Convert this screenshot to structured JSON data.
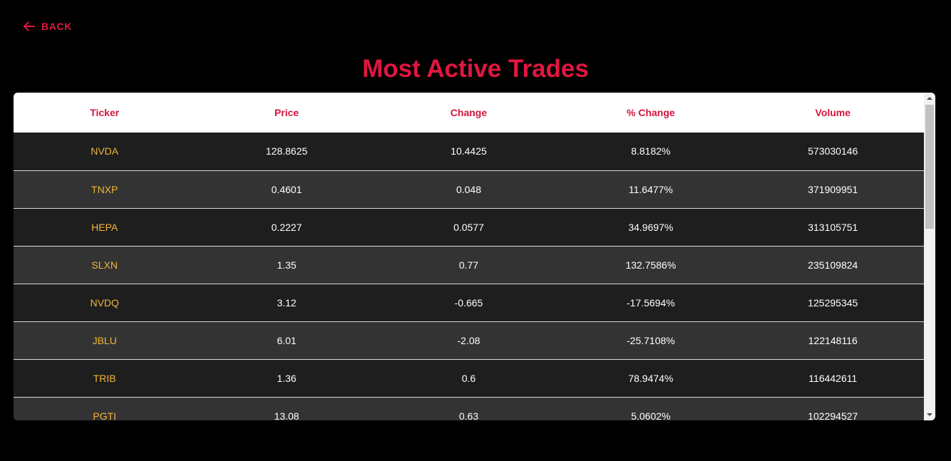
{
  "nav": {
    "back_label": "BACK",
    "back_icon": "arrow-left-icon"
  },
  "page": {
    "title": "Most Active Trades"
  },
  "colors": {
    "accent": "#e0173f",
    "ticker": "#f0b73a",
    "row_dark": "#1e1e1e",
    "row_light": "#333333",
    "header_bg": "#ffffff"
  },
  "table": {
    "columns": [
      "Ticker",
      "Price",
      "Change",
      "% Change",
      "Volume"
    ],
    "rows": [
      {
        "ticker": "NVDA",
        "price": "128.8625",
        "change": "10.4425",
        "pct_change": "8.8182%",
        "volume": "573030146"
      },
      {
        "ticker": "TNXP",
        "price": "0.4601",
        "change": "0.048",
        "pct_change": "11.6477%",
        "volume": "371909951"
      },
      {
        "ticker": "HEPA",
        "price": "0.2227",
        "change": "0.0577",
        "pct_change": "34.9697%",
        "volume": "313105751"
      },
      {
        "ticker": "SLXN",
        "price": "1.35",
        "change": "0.77",
        "pct_change": "132.7586%",
        "volume": "235109824"
      },
      {
        "ticker": "NVDQ",
        "price": "3.12",
        "change": "-0.665",
        "pct_change": "-17.5694%",
        "volume": "125295345"
      },
      {
        "ticker": "JBLU",
        "price": "6.01",
        "change": "-2.08",
        "pct_change": "-25.7108%",
        "volume": "122148116"
      },
      {
        "ticker": "TRIB",
        "price": "1.36",
        "change": "0.6",
        "pct_change": "78.9474%",
        "volume": "116442611"
      },
      {
        "ticker": "PGTI",
        "price": "13.08",
        "change": "0.63",
        "pct_change": "5.0602%",
        "volume": "102294527"
      }
    ]
  }
}
